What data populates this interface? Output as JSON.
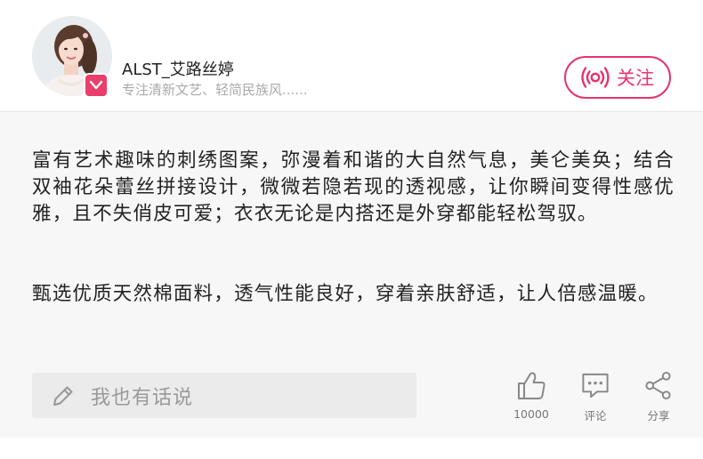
{
  "author": {
    "name": "ALST_艾路丝婷",
    "description": "专注清新文艺、轻简民族风......",
    "avatar_icon": "woman-portrait-avatar",
    "badge_icon": "v-verified-icon"
  },
  "follow": {
    "label": "关注",
    "icon": "live-broadcast-icon",
    "color": "#e8336b"
  },
  "content": {
    "paragraphs": [
      "富有艺术趣味的刺绣图案，弥漫着和谐的大自然气息，美仑美奂；结合双袖花朵蕾丝拼接设计，微微若隐若现的透视感，让你瞬间变得性感优雅，且不失俏皮可爱；衣衣无论是内搭还是外穿都能轻松驾驭。",
      "甄选优质天然棉面料，透气性能良好，穿着亲肤舒适，让人倍感温暖。"
    ]
  },
  "comment_input": {
    "placeholder": "我也有话说",
    "icon": "pencil-icon"
  },
  "actions": {
    "like": {
      "label": "10000",
      "icon": "thumbs-up-icon"
    },
    "comment": {
      "label": "评论",
      "icon": "comment-bubble-icon"
    },
    "share": {
      "label": "分享",
      "icon": "share-icon"
    }
  }
}
